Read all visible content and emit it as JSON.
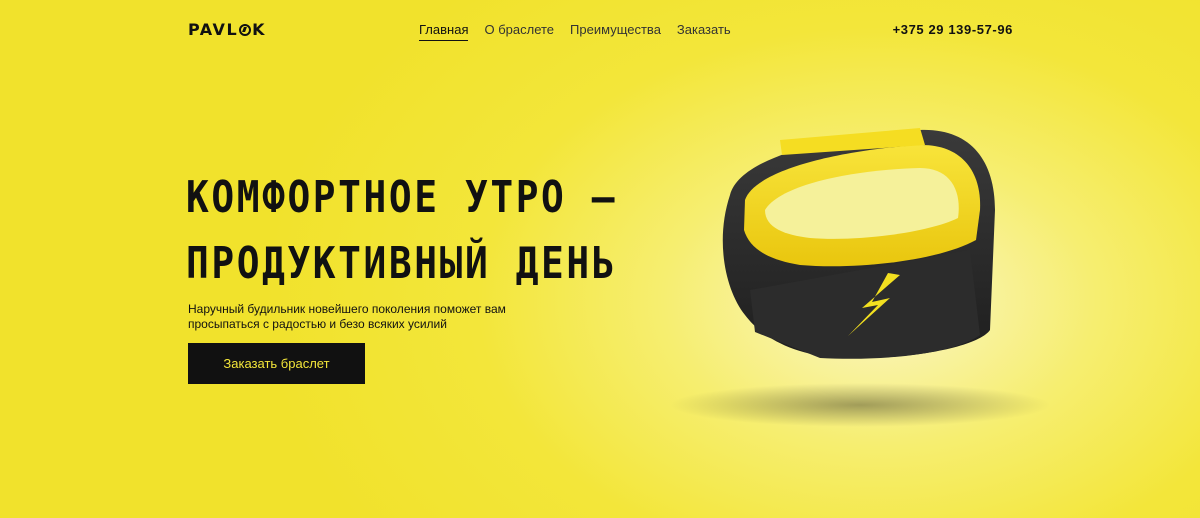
{
  "brand": {
    "logo_text_1": "PAVL",
    "logo_text_2": "K"
  },
  "nav": {
    "items": [
      {
        "label": "Главная"
      },
      {
        "label": "О браслете"
      },
      {
        "label": "Преимущества"
      },
      {
        "label": "Заказать"
      }
    ]
  },
  "contact": {
    "phone": "+375 29 139-57-96"
  },
  "hero": {
    "title_line_1": "КОМФОРТНОЕ УТРО —",
    "title_line_2": "ПРОДУКТИВНЫЙ ДЕНЬ",
    "subtitle": "Наручный будильник новейшего поколения поможет вам просыпаться с радостью и безо всяких усилий",
    "cta_label": "Заказать браслет"
  },
  "colors": {
    "accent": "#f3e63a",
    "dark": "#111111",
    "band_yellow": "#f2d618",
    "band_dark": "#2a2a2a"
  },
  "icons": {
    "product_icon": "lightning-bolt-icon"
  }
}
